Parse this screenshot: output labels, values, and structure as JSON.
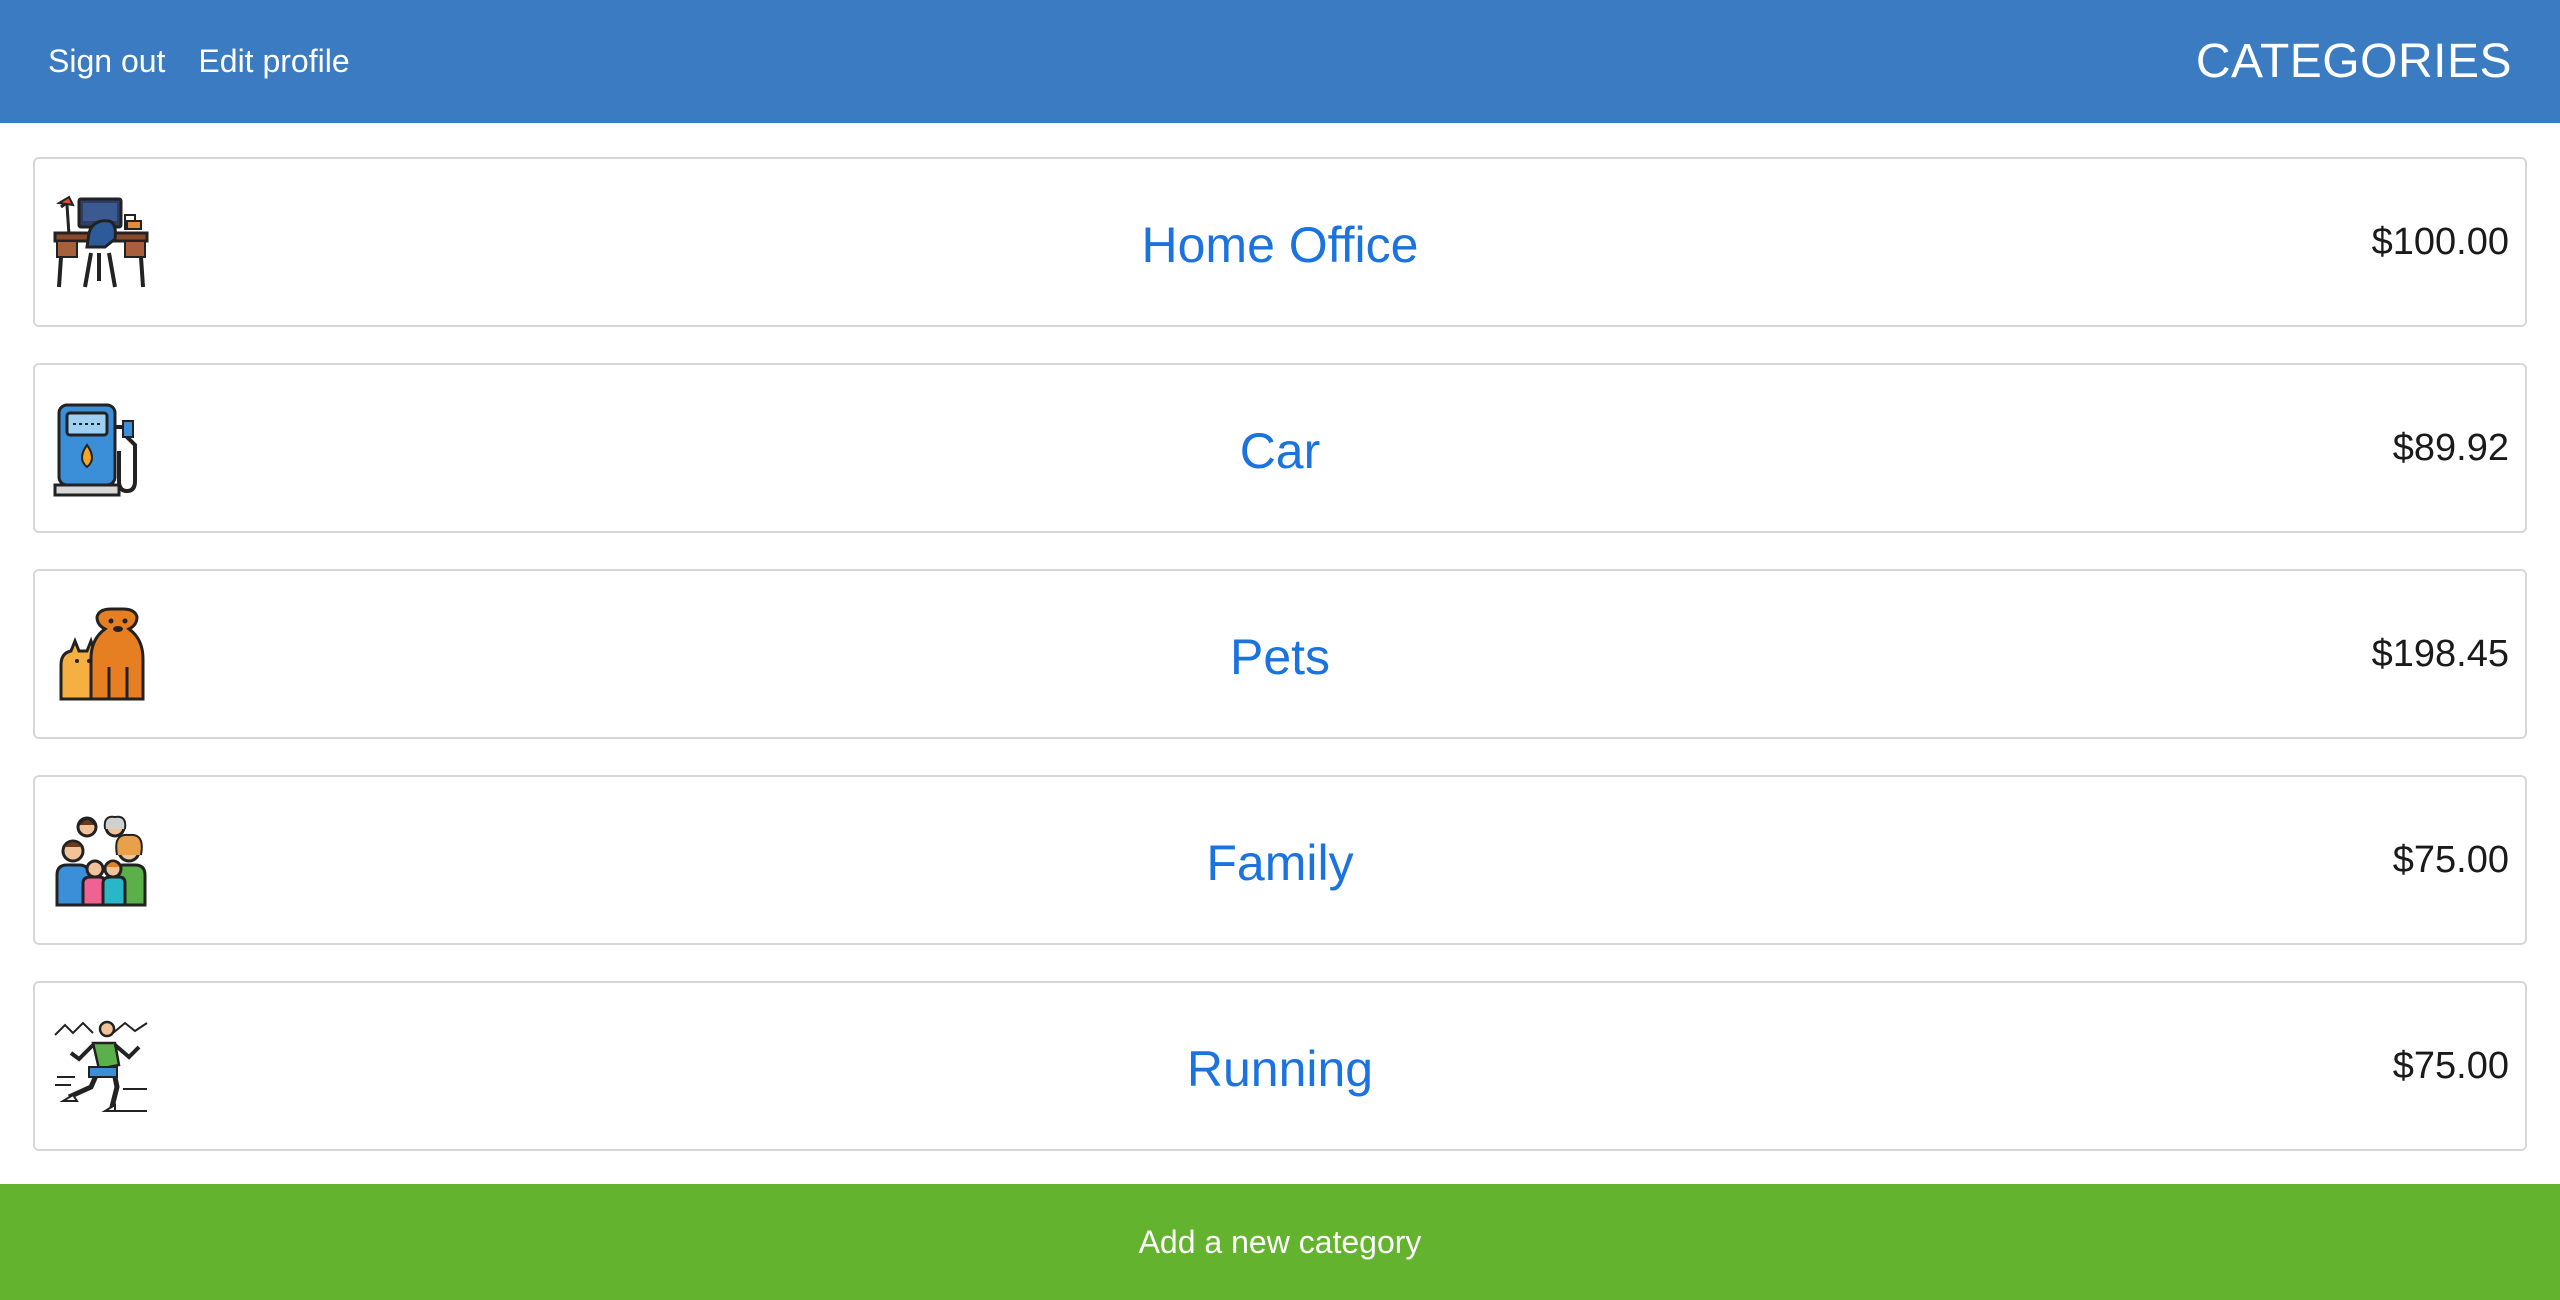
{
  "header": {
    "sign_out_label": "Sign out",
    "edit_profile_label": "Edit profile",
    "title": "CATEGORIES"
  },
  "categories": [
    {
      "name": "Home Office",
      "amount": "$100.00",
      "icon": "desk-icon"
    },
    {
      "name": "Car",
      "amount": "$89.92",
      "icon": "fuel-pump-icon"
    },
    {
      "name": "Pets",
      "amount": "$198.45",
      "icon": "pets-icon"
    },
    {
      "name": "Family",
      "amount": "$75.00",
      "icon": "family-icon"
    },
    {
      "name": "Running",
      "amount": "$75.00",
      "icon": "runner-icon"
    }
  ],
  "footer": {
    "add_label": "Add a new category"
  },
  "colors": {
    "header_bg": "#3b7bc2",
    "link_blue": "#1b73e0",
    "add_button_bg": "#63b32f"
  }
}
